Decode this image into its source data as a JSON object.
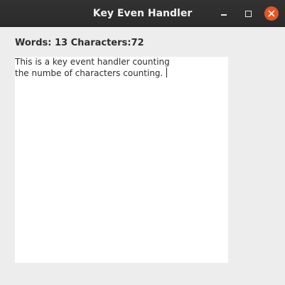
{
  "window": {
    "title": "Key Even Handler"
  },
  "stats": {
    "words_label": "Words:",
    "words_value": "13",
    "chars_label": "Characters:",
    "chars_value": "72"
  },
  "editor": {
    "text": "This is a key event handler counting\nthe numbe of characters counting. "
  },
  "colors": {
    "titlebar": "#2b2b2b",
    "close_button": "#e95420",
    "background": "#ededed",
    "editor_background": "#ffffff"
  },
  "icons": {
    "minimize": "minimize-icon",
    "maximize": "maximize-icon",
    "close": "close-icon"
  }
}
